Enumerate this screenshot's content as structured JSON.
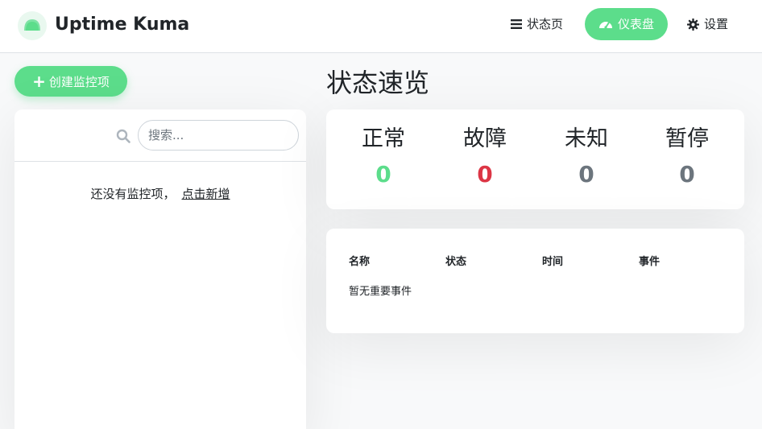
{
  "header": {
    "title": "Uptime Kuma",
    "logo_icon": "kuma-logo-icon",
    "nav": {
      "status_page": "状态页",
      "dashboard": "仪表盘",
      "settings": "设置"
    }
  },
  "colors": {
    "accent": "#5cdd8b",
    "up": "#5cdd8b",
    "down": "#dc3545",
    "unknown": "#6c757d",
    "pause": "#6c757d"
  },
  "sidebar": {
    "create_button": "创建监控项",
    "search": {
      "placeholder": "搜索...",
      "value": ""
    },
    "empty_text": "还没有监控项，",
    "empty_link": "点击新增"
  },
  "overview": {
    "title": "状态速览",
    "stats": [
      {
        "label": "正常",
        "value": "0"
      },
      {
        "label": "故障",
        "value": "0"
      },
      {
        "label": "未知",
        "value": "0"
      },
      {
        "label": "暂停",
        "value": "0"
      }
    ]
  },
  "events": {
    "columns": [
      "名称",
      "状态",
      "时间",
      "事件"
    ],
    "empty": "暂无重要事件"
  }
}
